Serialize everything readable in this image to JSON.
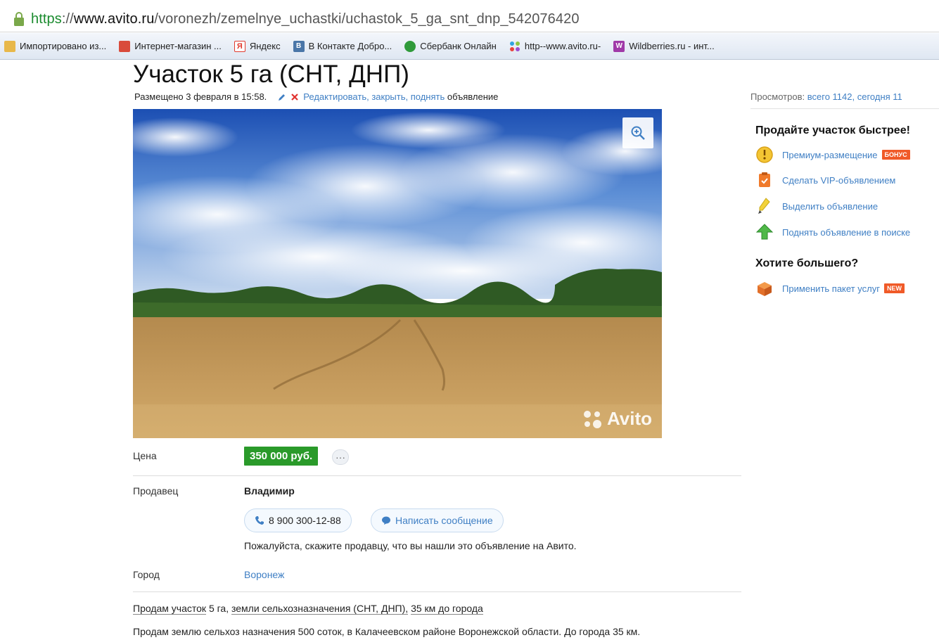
{
  "browser": {
    "url_scheme": "https",
    "url_sep": "://",
    "url_host": "www.avito.ru",
    "url_path": "/voronezh/zemelnye_uchastki/uchastok_5_ga_snt_dnp_542076420",
    "bookmarks": [
      {
        "label": "Импортировано из...",
        "icon": "folder-icon",
        "color": "#e8b84a"
      },
      {
        "label": "Интернет-магазин ...",
        "icon": "shop-icon",
        "color": "#d94b3b"
      },
      {
        "label": "Яндекс",
        "icon": "yandex-icon",
        "color": "#e03a2e"
      },
      {
        "label": "В Контакте Добро...",
        "icon": "vk-icon",
        "color": "#4a76a8"
      },
      {
        "label": "Сбербанк Онлайн",
        "icon": "sberbank-icon",
        "color": "#2f9a3a"
      },
      {
        "label": "http--www.avito.ru-",
        "icon": "avito-icon",
        "color": "#3aa0e0"
      },
      {
        "label": "Wildberries.ru - инт...",
        "icon": "wildberries-icon",
        "color": "#a03aa8"
      }
    ]
  },
  "listing": {
    "title": "Участок 5 га (СНТ, ДНП)",
    "posted": "Размещено 3 февраля в 15:58.",
    "actions_links": "Редактировать, закрыть, поднять",
    "actions_tail": "объявление",
    "views_label": "Просмотров:",
    "views_total": "всего 1142,",
    "views_today": "сегодня 11",
    "watermark": "Avito",
    "price_label": "Цена",
    "price": "350 000 руб.",
    "more_label": "···",
    "seller_label": "Продавец",
    "seller_name": "Владимир",
    "phone": "8 900 300-12-88",
    "message_btn": "Написать сообщение",
    "note": "Пожалуйста, скажите продавцу, что вы нашли это объявление на Авито.",
    "city_label": "Город",
    "city": "Воронеж",
    "params_a": "Продам участок",
    "params_b": "5 га,",
    "params_c": "земли сельхозназначения (СНТ, ДНП),",
    "params_d": "35 км до города",
    "description": "Продам землю сельхоз назначения 500 соток, в Калачеевском районе Воронежской области. До города 35 км."
  },
  "sidebar": {
    "promo_title": "Продайте участок быстрее!",
    "items": [
      {
        "label": "Премиум-размещение",
        "tag": "бонус",
        "icon": "premium-icon"
      },
      {
        "label": "Сделать VIP-объявлением",
        "tag": "",
        "icon": "vip-icon"
      },
      {
        "label": "Выделить объявление",
        "tag": "",
        "icon": "highlight-icon"
      },
      {
        "label": "Поднять объявление в поиске",
        "tag": "",
        "icon": "up-arrow-icon"
      }
    ],
    "more_title": "Хотите большего?",
    "package_label": "Применить пакет услуг",
    "package_tag": "new"
  },
  "colors": {
    "link": "#3f7fc4",
    "price_bg": "#2a9a2a",
    "tag_bg": "#f05a28",
    "url_scheme": "#1a8b2e"
  }
}
